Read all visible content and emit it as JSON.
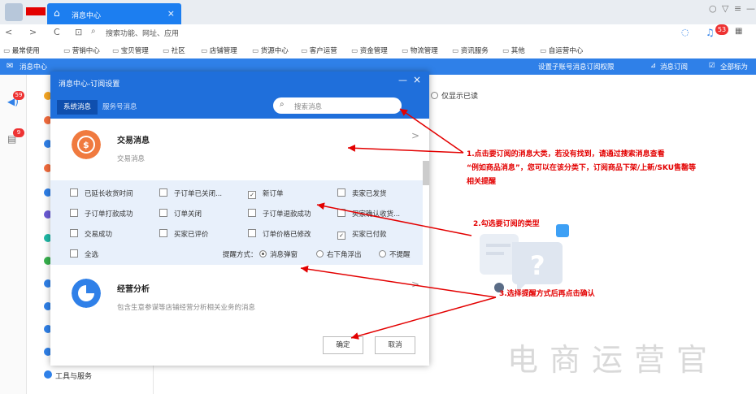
{
  "window": {
    "tab_title": "消息中心",
    "tab_close": "×",
    "controls": [
      "○",
      "▽",
      "≡",
      "—"
    ],
    "notif_count": "53"
  },
  "address_bar": {
    "back": "<",
    "forward": ">",
    "reload": "C",
    "text": "搜索功能、网址、应用"
  },
  "bookmarks": [
    "最常使用",
    "营销中心",
    "宝贝管理",
    "社区",
    "店铺管理",
    "货源中心",
    "客户运营",
    "资金管理",
    "物流管理",
    "资讯服务",
    "其他",
    "自运营中心"
  ],
  "app_header": {
    "title": "消息中心",
    "sub_perm": "设置子账号消息订阅权限",
    "subscribe": "消息订阅",
    "mark_all": "全部标为"
  },
  "rail": {
    "badge1": "59",
    "badge2": "9"
  },
  "sidebar": {
    "tools": "工具与服务"
  },
  "main": {
    "only_show": "仅显示已读"
  },
  "dialog": {
    "title": "消息中心-订阅设置",
    "min": "—",
    "close": "×",
    "tab_system": "系统消息",
    "tab_service": "服务号消息",
    "search_placeholder": "搜索消息",
    "section1": {
      "title": "交易消息",
      "desc": "交易消息",
      "arrow": ">"
    },
    "options": [
      {
        "label": "已延长收货时间",
        "checked": false
      },
      {
        "label": "子订单已关闭...",
        "checked": false
      },
      {
        "label": "新订单",
        "checked": true
      },
      {
        "label": "卖家已发货",
        "checked": false
      },
      {
        "label": "子订单打款成功",
        "checked": false
      },
      {
        "label": "订单关闭",
        "checked": false
      },
      {
        "label": "子订单退款成功",
        "checked": false
      },
      {
        "label": "买家确认收货...",
        "checked": false
      },
      {
        "label": "交易成功",
        "checked": false
      },
      {
        "label": "买家已评价",
        "checked": false
      },
      {
        "label": "订单价格已修改",
        "checked": false
      },
      {
        "label": "买家已付款",
        "checked": true
      }
    ],
    "select_all": "全选",
    "reminder_label": "提醒方式：",
    "reminder_options": [
      {
        "label": "消息弹窗",
        "selected": true
      },
      {
        "label": "右下角浮出",
        "selected": false
      },
      {
        "label": "不提醒",
        "selected": false
      }
    ],
    "section2": {
      "title": "经营分析",
      "desc": "包含生意参谋等店铺经营分析相关业务的消息",
      "arrow": ">"
    },
    "ok": "确定",
    "cancel": "取消"
  },
  "annotations": {
    "a1_line1": "1.点击要订阅的消息大类，若没有找到，请通过搜索消息查看",
    "a1_line2": "“例如商品消息”，您可以在该分类下，订阅商品下架/上新/SKU售罄等",
    "a1_line3": "相关提醒",
    "a2": "2.勾选要订阅的类型",
    "a3": "3.选择提醒方式后再点击确认"
  },
  "watermark": "电商运营官",
  "colors": {
    "brand_blue": "#1f6fdb",
    "annotation_red": "#e30000",
    "badge_red": "#e33333"
  }
}
